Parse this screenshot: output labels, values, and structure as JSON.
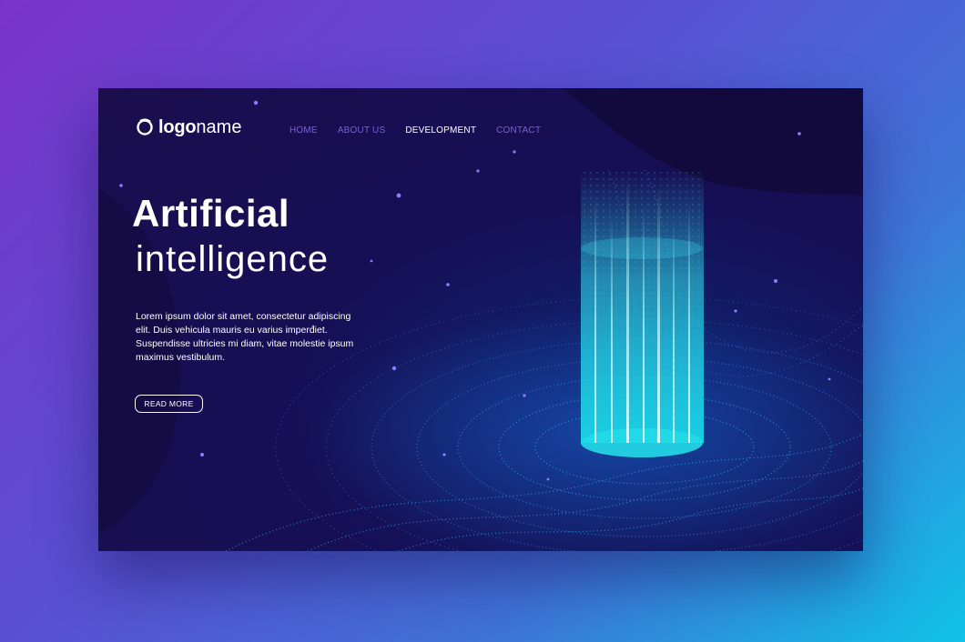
{
  "logo": {
    "bold": "logo",
    "light": "name",
    "icon": "logo-ring-icon"
  },
  "nav": {
    "items": [
      {
        "label": "HOME"
      },
      {
        "label": "ABOUT US"
      },
      {
        "label": "DEVELOPMENT"
      },
      {
        "label": "CONTACT"
      }
    ],
    "active_index": 2
  },
  "hero": {
    "title": "Artificial",
    "subtitle": "intelligence",
    "body": "Lorem ipsum dolor sit amet, consectetur adipiscing elit. Duis vehicula mauris eu varius imperdiet. Suspendisse ultricies mi diam, vitae molestie ipsum maximus vestibulum.",
    "cta": "READ MORE"
  },
  "colors": {
    "background_start": "#7a33c9",
    "background_end": "#10c3e6",
    "card": "#1a0e4d",
    "nav_link": "#7c5fd6",
    "nav_active": "#ffffff",
    "glow": "#2ee6f0"
  }
}
